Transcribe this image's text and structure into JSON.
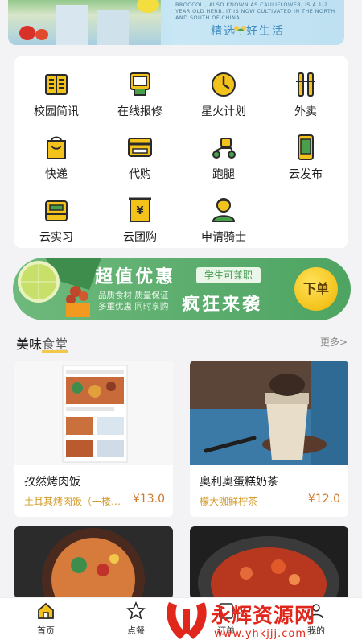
{
  "top_banner": {
    "english_text": "BROCCOLI, ALSO KNOWN AS CAULIFLOWER, IS A 1-2 YEAR OLD HERB. IT IS NOW CULTIVATED IN THE NORTH AND SOUTH OF CHINA.",
    "slogan_left": "精选",
    "slogan_right": "好生活"
  },
  "services": [
    {
      "label": "校园简讯",
      "icon": "news-icon"
    },
    {
      "label": "在线报修",
      "icon": "repair-icon"
    },
    {
      "label": "星火计划",
      "icon": "clock-icon"
    },
    {
      "label": "外卖",
      "icon": "chopsticks-icon"
    },
    {
      "label": "快递",
      "icon": "bag-icon"
    },
    {
      "label": "代购",
      "icon": "card-icon"
    },
    {
      "label": "跑腿",
      "icon": "scooter-icon"
    },
    {
      "label": "云发布",
      "icon": "phone-icon"
    },
    {
      "label": "云实习",
      "icon": "box-icon"
    },
    {
      "label": "云团购",
      "icon": "receipt-icon"
    },
    {
      "label": "申请骑士",
      "icon": "rider-icon"
    }
  ],
  "promo": {
    "title": "超值优惠",
    "tag": "学生可兼职",
    "line1": "品质食材 质量保证",
    "line2": "多重优惠 同时享购",
    "subtitle": "疯狂来袭",
    "button": "下单"
  },
  "section": {
    "title_main": "美味",
    "title_sub": "食堂",
    "more": "更多>"
  },
  "cards": [
    {
      "name": "孜然烤肉饭",
      "desc": "土耳其烤肉饭（一楼酱…",
      "price": "¥13.0"
    },
    {
      "name": "奥利奥蛋糕奶茶",
      "desc": "檬大咖鲜柠茶",
      "price": "¥12.0"
    }
  ],
  "bottom_nav": [
    {
      "label": "首页",
      "icon": "home-icon"
    },
    {
      "label": "点餐",
      "icon": "star-icon"
    },
    {
      "label": "订单",
      "icon": "order-icon"
    },
    {
      "label": "我的",
      "icon": "user-icon"
    }
  ],
  "watermark": {
    "text": "永辉资源网",
    "url": "www.yhkjjj.com"
  },
  "colors": {
    "accent_green": "#5aac6c",
    "accent_yellow": "#f4c31b",
    "price": "#d0772a"
  }
}
